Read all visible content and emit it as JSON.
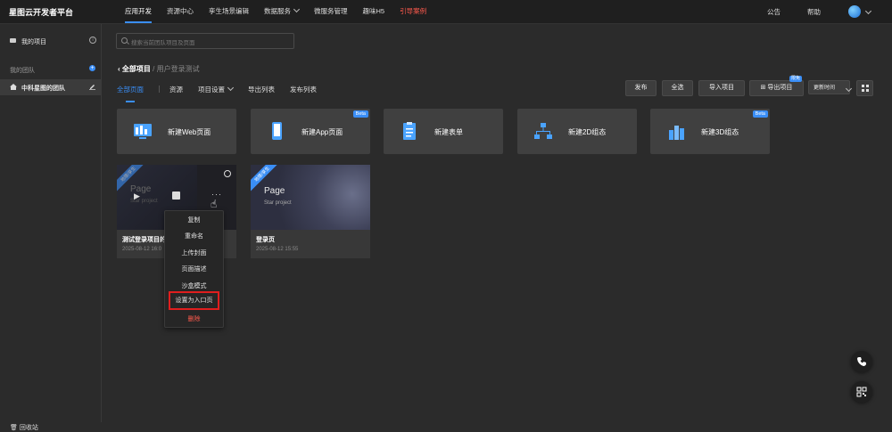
{
  "app": {
    "title": "星图云开发者平台"
  },
  "topnav": {
    "items": [
      "应用开发",
      "资源中心",
      "孪生场景编辑",
      "数据服务",
      "微服务管理",
      "趣味H5",
      "引导案例"
    ]
  },
  "top_right": {
    "announce": "公告",
    "help": "帮助"
  },
  "sidebar": {
    "my_projects": "我的项目",
    "my_team": "我的团队",
    "team_name": "中科星图的团队",
    "recycle": "回收站"
  },
  "search": {
    "placeholder": "搜索当前团队项目及页面"
  },
  "breadcrumb": {
    "root": "全部项目",
    "sep": "/",
    "current": "用户登录测试"
  },
  "tabs": [
    "全部页面",
    "资源",
    "项目设置",
    "导出列表",
    "发布列表"
  ],
  "toolbar": {
    "publish": "发布",
    "select_all": "全选",
    "import": "导入项目",
    "export": "导出项目",
    "export_badge": "限免",
    "sort": "更新时间"
  },
  "new_cards": [
    {
      "label": "新建Web页面",
      "beta": ""
    },
    {
      "label": "新建App页面",
      "beta": "Beta"
    },
    {
      "label": "新建表单",
      "beta": ""
    },
    {
      "label": "新建2D组态",
      "beta": ""
    },
    {
      "label": "新建3D组态",
      "beta": "Beta"
    }
  ],
  "projects": [
    {
      "name": "测试登录项目的",
      "time": "2025-08-12 16:0",
      "ribbon": "地理/孪生",
      "thumb_title": "Page",
      "thumb_sub": "Star project"
    },
    {
      "name": "登录页",
      "time": "2025-08-12 15:55",
      "ribbon": "地理/孪生",
      "thumb_title": "Page",
      "thumb_sub": "Star project"
    }
  ],
  "context_menu": [
    "复制",
    "重命名",
    "上传封面",
    "页面描述",
    "沙盒模式",
    "设置为入口页",
    "删除"
  ],
  "colors": {
    "accent": "#3a8ef6",
    "danger": "#ff5a4d",
    "highlight_box": "#e01e1e"
  }
}
